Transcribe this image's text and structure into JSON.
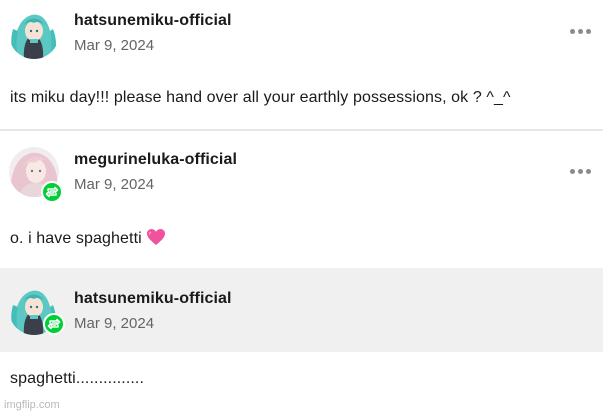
{
  "colors": {
    "username": "#1a1a1a",
    "date": "#646464",
    "reblog_badge": "#00cf35",
    "divider": "#e6e6e6",
    "gray_band": "#f0f0f0",
    "heart": "#f0529c"
  },
  "posts": [
    {
      "username": "hatsunemiku-official",
      "date": "Mar 9, 2024",
      "text": "its miku day!!! please hand over all your earthly possessions, ok ? ^_^",
      "avatar_icon": "miku-avatar",
      "reblog": false
    },
    {
      "username": "megurineluka-official",
      "date": "Mar 9, 2024",
      "text": "o. i have spaghetti",
      "avatar_icon": "luka-avatar",
      "reblog": true,
      "emoji": "pink-heart"
    },
    {
      "username": "hatsunemiku-official",
      "date": "Mar 9, 2024",
      "text": "spaghetti...............",
      "avatar_icon": "miku-avatar",
      "reblog": true
    }
  ],
  "watermark": "imgflip.com"
}
